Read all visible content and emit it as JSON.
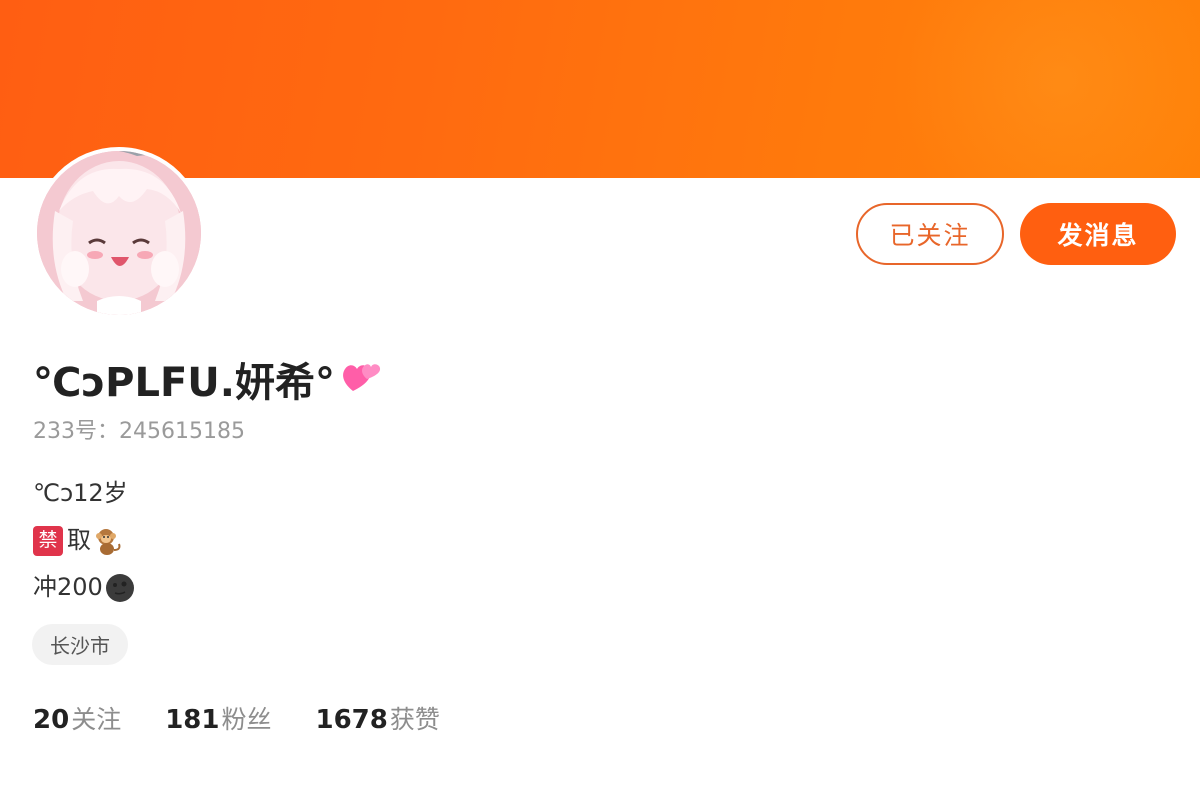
{
  "profile": {
    "nickname": "℃ↄPLFU.妍希°",
    "nickname_emoji": "heart-emoji",
    "uid_label": "233号：",
    "uid_value": "245615185",
    "bio": {
      "line1": "℃ↄ12岁",
      "line2_text": "取",
      "line2_ban_glyph": "禁",
      "line3": "冲200"
    },
    "location": "长沙市"
  },
  "actions": {
    "follow_label": "已关注",
    "message_label": "发消息"
  },
  "stats": [
    {
      "value": "20",
      "label": "关注"
    },
    {
      "value": "181",
      "label": "粉丝"
    },
    {
      "value": "1678",
      "label": "获赞"
    }
  ],
  "colors": {
    "accent": "#ff5f10",
    "banner": "#ff6a10",
    "follow_border": "#e8662a"
  }
}
